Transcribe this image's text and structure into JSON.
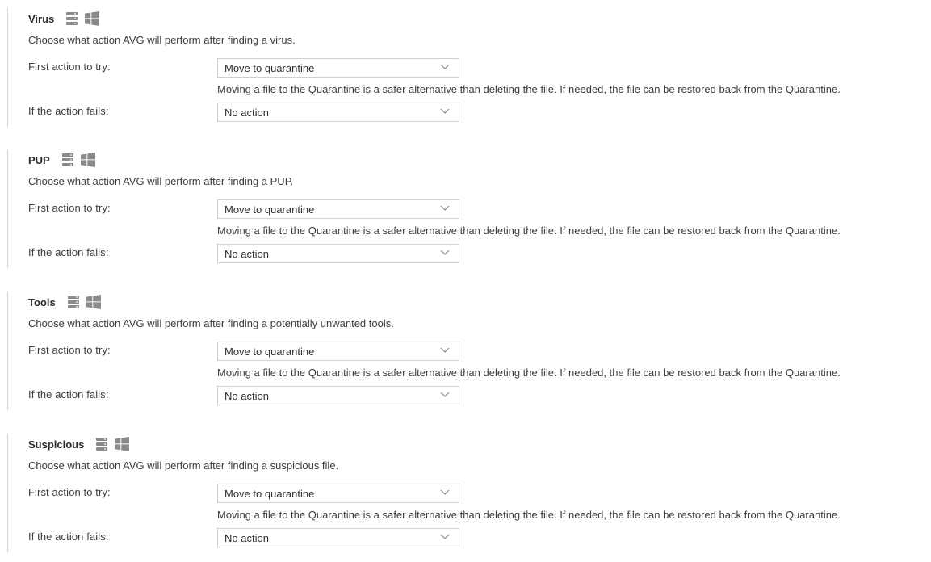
{
  "sections": [
    {
      "title": "Virus",
      "description": "Choose what action AVG will perform after finding a virus.",
      "first_action_label": "First action to try:",
      "first_action_value": "Move to quarantine",
      "hint": "Moving a file to the Quarantine is a safer alternative than deleting the file. If needed, the file can be restored back from the Quarantine.",
      "fail_action_label": "If the action fails:",
      "fail_action_value": "No action",
      "icons": [
        "server-icon",
        "windows-icon"
      ]
    },
    {
      "title": "PUP",
      "description": "Choose what action AVG will perform after finding a PUP.",
      "first_action_label": "First action to try:",
      "first_action_value": "Move to quarantine",
      "hint": "Moving a file to the Quarantine is a safer alternative than deleting the file. If needed, the file can be restored back from the Quarantine.",
      "fail_action_label": "If the action fails:",
      "fail_action_value": "No action",
      "icons": [
        "server-icon",
        "windows-icon"
      ]
    },
    {
      "title": "Tools",
      "description": "Choose what action AVG will perform after finding a potentially unwanted tools.",
      "first_action_label": "First action to try:",
      "first_action_value": "Move to quarantine",
      "hint": "Moving a file to the Quarantine is a safer alternative than deleting the file. If needed, the file can be restored back from the Quarantine.",
      "fail_action_label": "If the action fails:",
      "fail_action_value": "No action",
      "icons": [
        "server-icon",
        "windows-icon"
      ]
    },
    {
      "title": "Suspicious",
      "description": "Choose what action AVG will perform after finding a suspicious file.",
      "first_action_label": "First action to try:",
      "first_action_value": "Move to quarantine",
      "hint": "Moving a file to the Quarantine is a safer alternative than deleting the file. If needed, the file can be restored back from the Quarantine.",
      "fail_action_label": "If the action fails:",
      "fail_action_value": "No action",
      "icons": [
        "server-icon",
        "windows-icon"
      ]
    }
  ],
  "colors": {
    "icon_gray": "#8a8a8a",
    "text": "#3c3c3c",
    "border": "#cfcfcf"
  }
}
